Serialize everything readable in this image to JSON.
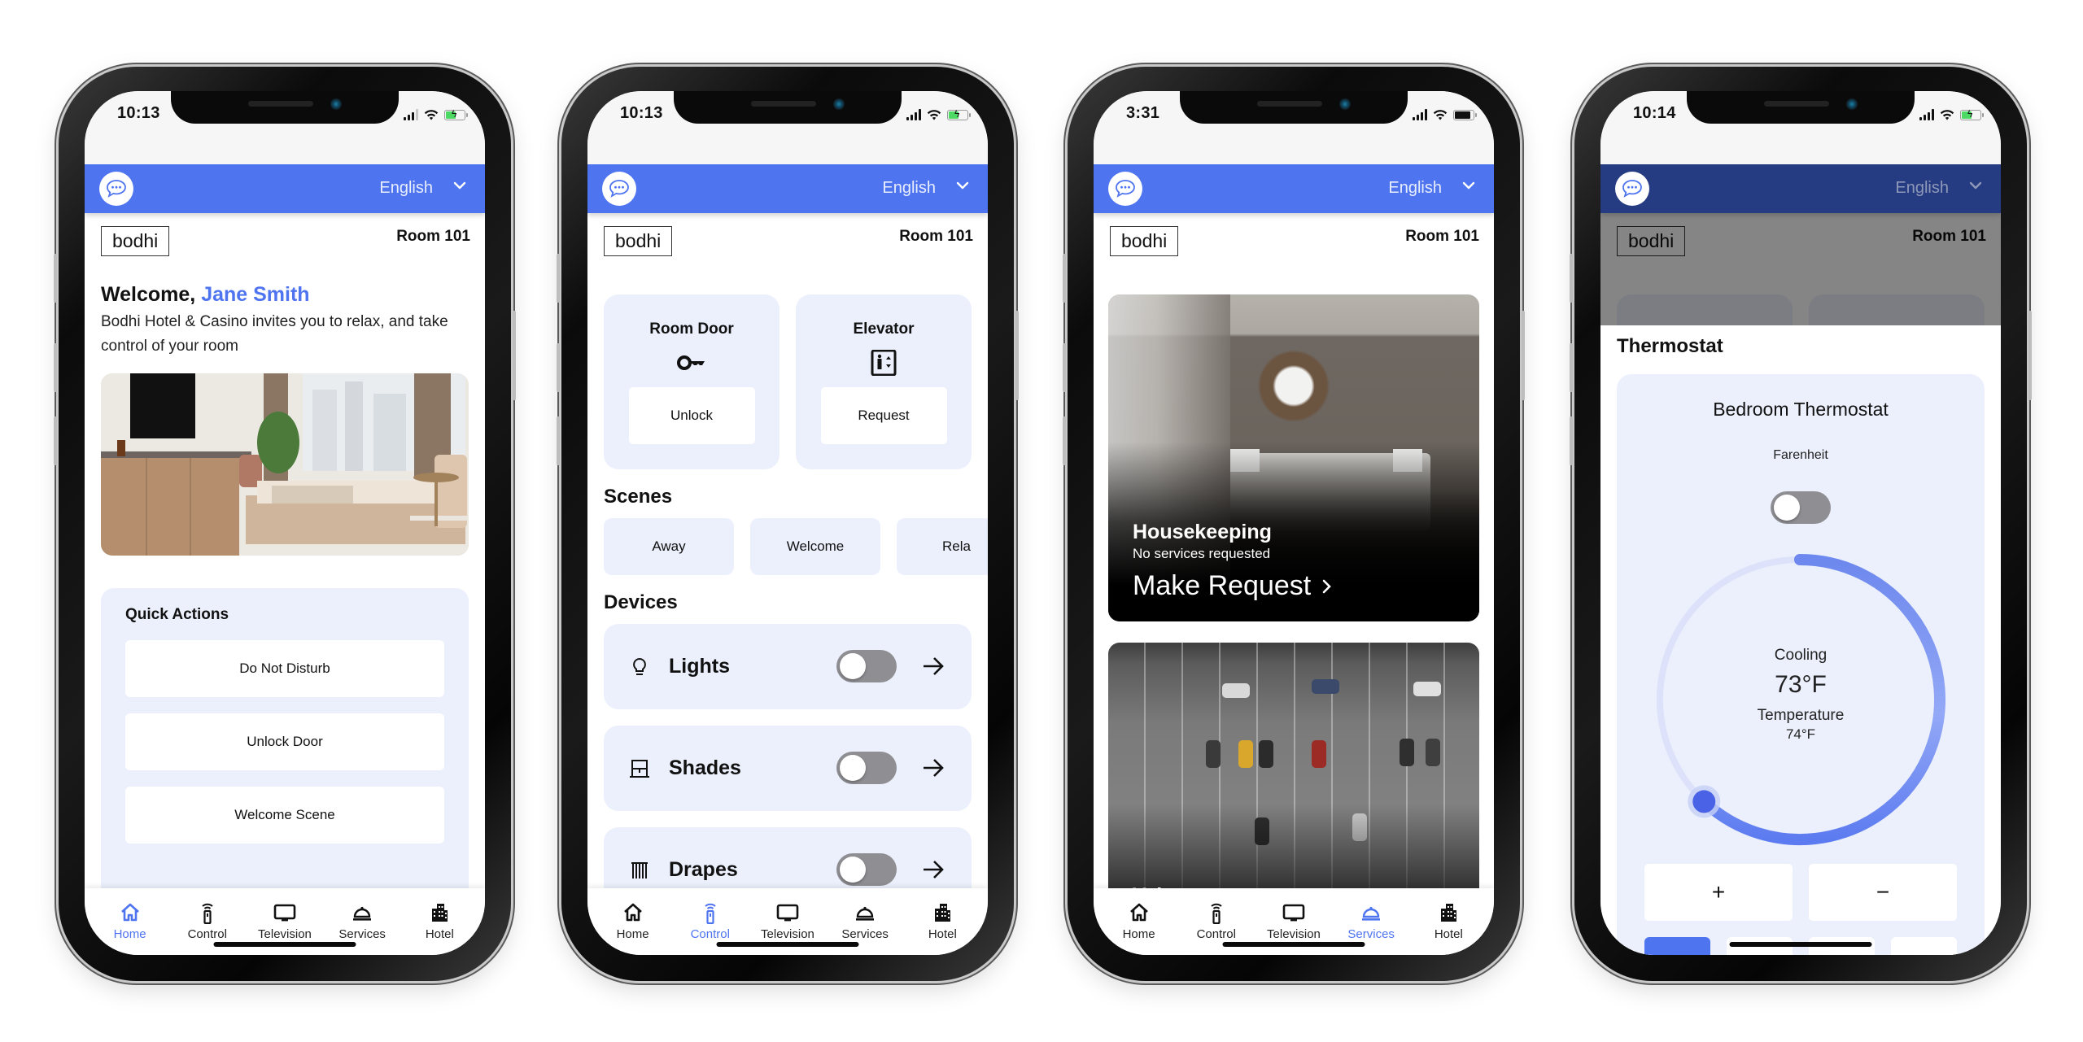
{
  "colors": {
    "accent": "#4e74f0",
    "card_bg": "#ebf0fc",
    "toggle_off": "#8e8e93",
    "header_dimmed": "#263c82"
  },
  "common": {
    "language": "English",
    "logo": "bodhi",
    "room": "Room 101",
    "tabs": [
      {
        "label": "Home",
        "icon": "home-icon"
      },
      {
        "label": "Control",
        "icon": "remote-control-icon"
      },
      {
        "label": "Television",
        "icon": "television-icon"
      },
      {
        "label": "Services",
        "icon": "service-bell-icon"
      },
      {
        "label": "Hotel",
        "icon": "building-icon"
      }
    ]
  },
  "screens": [
    {
      "id": "home",
      "status_time": "10:13",
      "battery": "charging",
      "active_tab": "Home",
      "welcome_prefix": "Welcome, ",
      "guest_name": "Jane Smith",
      "welcome_text": "Bodhi Hotel & Casino invites you to relax, and take control of your room",
      "hero_image": "hotel-room-photo",
      "quick_actions": {
        "title": "Quick Actions",
        "buttons": [
          "Do Not Disturb",
          "Unlock Door",
          "Welcome Scene"
        ]
      }
    },
    {
      "id": "control",
      "status_time": "10:13",
      "battery": "charging",
      "active_tab": "Control",
      "cards": [
        {
          "title": "Room Door",
          "icon": "key-icon",
          "button": "Unlock"
        },
        {
          "title": "Elevator",
          "icon": "elevator-icon",
          "button": "Request"
        }
      ],
      "scenes_title": "Scenes",
      "scenes": [
        "Away",
        "Welcome",
        "Rela"
      ],
      "devices_title": "Devices",
      "devices": [
        {
          "label": "Lights",
          "icon": "lightbulb-icon",
          "on": false
        },
        {
          "label": "Shades",
          "icon": "shades-icon",
          "on": false
        },
        {
          "label": "Drapes",
          "icon": "drapes-icon",
          "on": false
        }
      ]
    },
    {
      "id": "services",
      "status_time": "3:31",
      "battery": "full",
      "active_tab": "Services",
      "services": [
        {
          "title": "Housekeeping",
          "status": "No services requested",
          "action": "Make Request",
          "image": "bedroom-photo"
        },
        {
          "title": "Valet",
          "image": "parking-lot-photo"
        }
      ]
    },
    {
      "id": "thermostat",
      "status_time": "10:14",
      "battery": "charging",
      "sheet_title": "Thermostat",
      "device_name": "Bedroom Thermostat",
      "unit_label": "Farenheit",
      "unit_toggle_on": false,
      "mode": "Cooling",
      "setpoint": "73°F",
      "current_label": "Temperature",
      "current_temp": "74°F",
      "dial_fill_fraction": 0.62,
      "plus_label": "+",
      "minus_label": "−",
      "mode_buttons_active_index": 0
    }
  ]
}
